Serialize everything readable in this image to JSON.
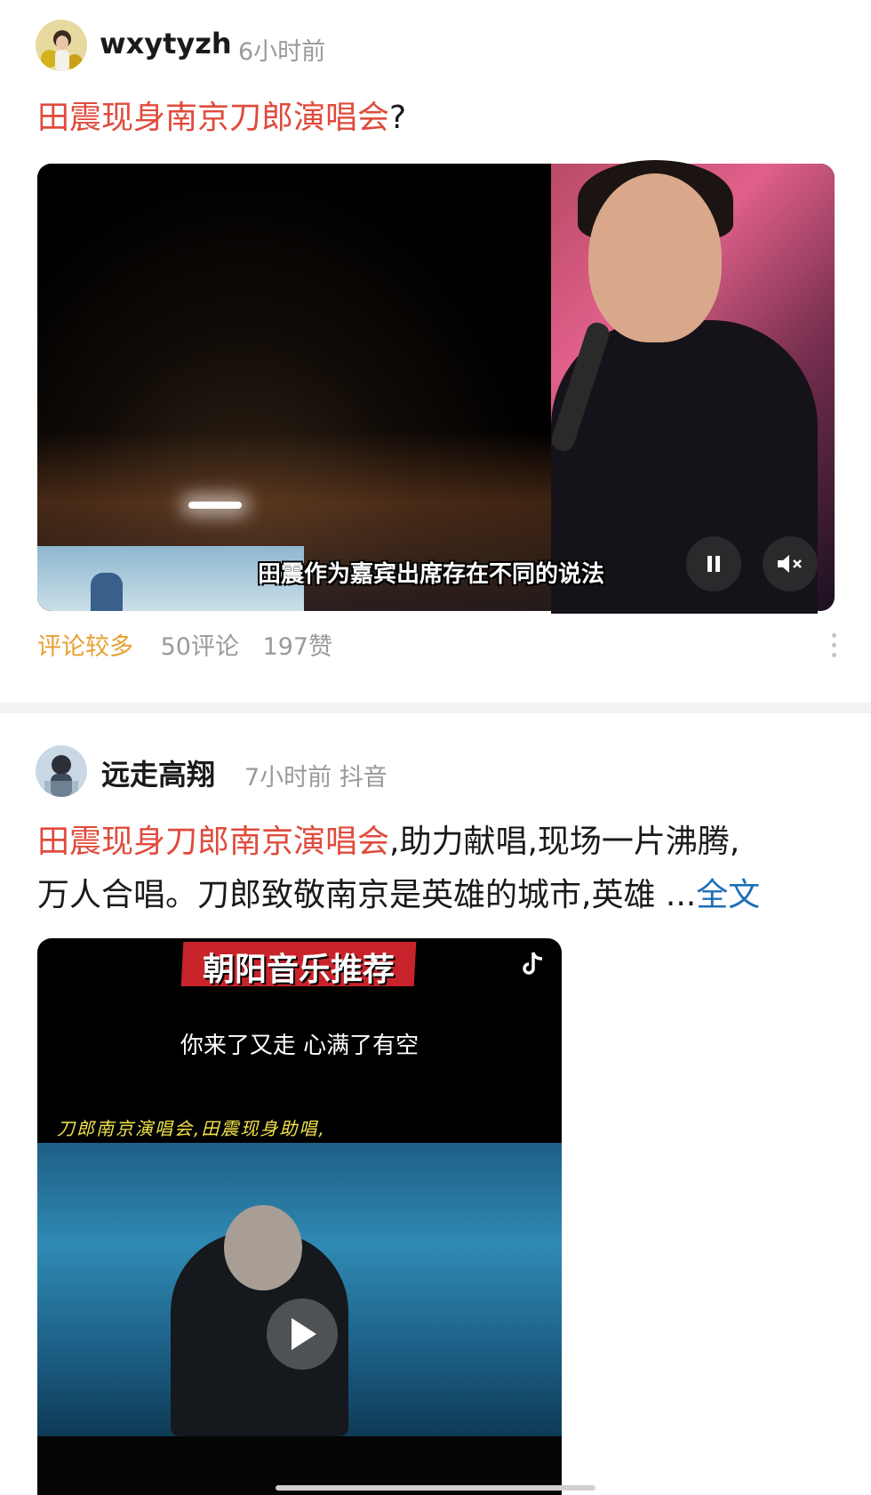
{
  "posts": [
    {
      "username": "wxytyzh",
      "time": "6小时前",
      "source": "",
      "headline_highlight": "田震现身南京刀郎演唱会",
      "headline_rest": "?",
      "video_subtitle": "田震作为嘉宾出席存在不同的说法",
      "tag": "评论较多",
      "comments": "50评论",
      "likes": "197赞"
    },
    {
      "username": "远走高翔",
      "time": "7小时前",
      "source": "抖音",
      "headline_highlight": "田震现身刀郎南京演唱会",
      "headline_rest_line1": ",助力献唱,现场一片沸腾,",
      "headline_line2": "万人合唱。刀郎致敬南京是英雄的城市,英雄 ...",
      "more_label": "全文",
      "video_banner": "朝阳音乐推荐",
      "video_lyric": "你来了又走 心满了有空",
      "video_caption": "刀郎南京演唱会,田震现身助唱,"
    }
  ],
  "icons": {
    "pause": "pause-icon",
    "mute": "mute-icon",
    "play": "play-icon",
    "tiktok": "tiktok-icon",
    "more": "more-vertical-icon"
  },
  "colors": {
    "highlight": "#e04b3c",
    "hot_tag": "#e6a032",
    "link": "#1d6fb8",
    "muted": "#9a9a9a"
  }
}
